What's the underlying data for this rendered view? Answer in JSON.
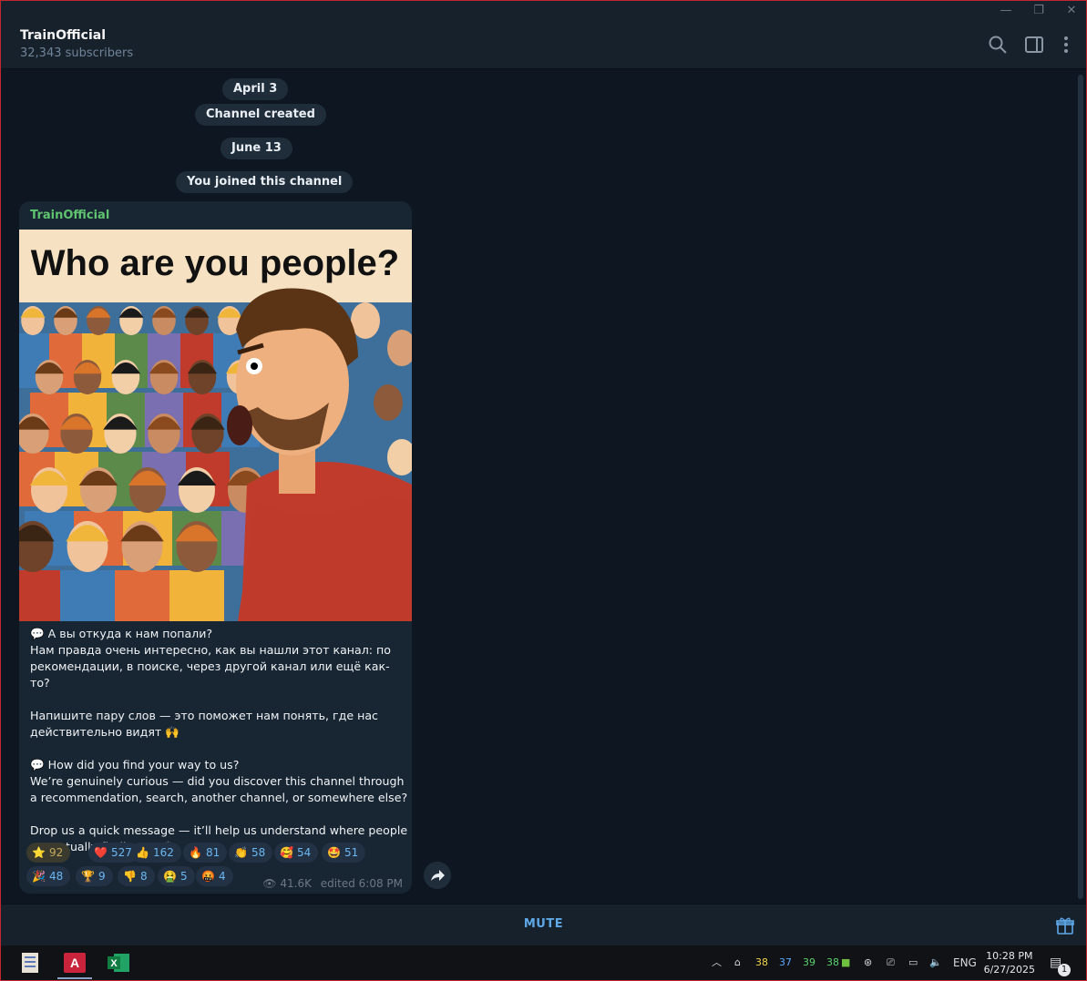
{
  "window": {
    "minimize": "—",
    "restore": "❐",
    "close": "✕"
  },
  "header": {
    "title": "TrainOfficial",
    "subtitle": "32,343 subscribers",
    "icons": [
      "search-icon",
      "sidebar-toggle-icon",
      "more-icon"
    ]
  },
  "service": {
    "date1": "April 3",
    "created": "Channel created",
    "date2": "June 13",
    "joined": "You joined this channel"
  },
  "post": {
    "author": "TrainOfficial",
    "image_headline": "Who are you people?",
    "text": "💬 А вы откуда к нам попали?\nНам правда очень интересно, как вы нашли этот канал: по рекомендации, в поиске, через другой канал или ещё как-то?\n\nНапишите пару слов — это поможет нам понять, где нас действительно видят 🙌\n\n💬 How did you find your way to us?\nWe’re genuinely curious — did you discover this channel through a recommendation, search, another channel, or somewhere else?\n\nDrop us a quick message — it’ll help us understand where people are actually finding us 🙌",
    "reactions": [
      {
        "emoji": "⭐",
        "count": "92"
      },
      {
        "emoji": "❤️",
        "count": "527"
      },
      {
        "emoji": "👍",
        "count": "162"
      },
      {
        "emoji": "🔥",
        "count": "81"
      },
      {
        "emoji": "👏",
        "count": "58"
      },
      {
        "emoji": "🥰",
        "count": "54"
      },
      {
        "emoji": "🤩",
        "count": "51"
      },
      {
        "emoji": "🎉",
        "count": "48"
      },
      {
        "emoji": "🏆",
        "count": "9"
      },
      {
        "emoji": "👎",
        "count": "8"
      },
      {
        "emoji": "🤮",
        "count": "5"
      },
      {
        "emoji": "🤬",
        "count": "4"
      }
    ],
    "views": "41.6K",
    "edited": "edited 6:08 PM"
  },
  "bottom": {
    "mute": "MUTE"
  },
  "taskbar": {
    "temps": [
      "38",
      "37",
      "39",
      "38"
    ],
    "temp_colors": [
      "#f2d44a",
      "#5aa8ff",
      "#5ad36a",
      "#5ad36a"
    ],
    "lang": "ENG",
    "time": "10:28 PM",
    "date": "6/27/2025",
    "notif_count": "1"
  }
}
